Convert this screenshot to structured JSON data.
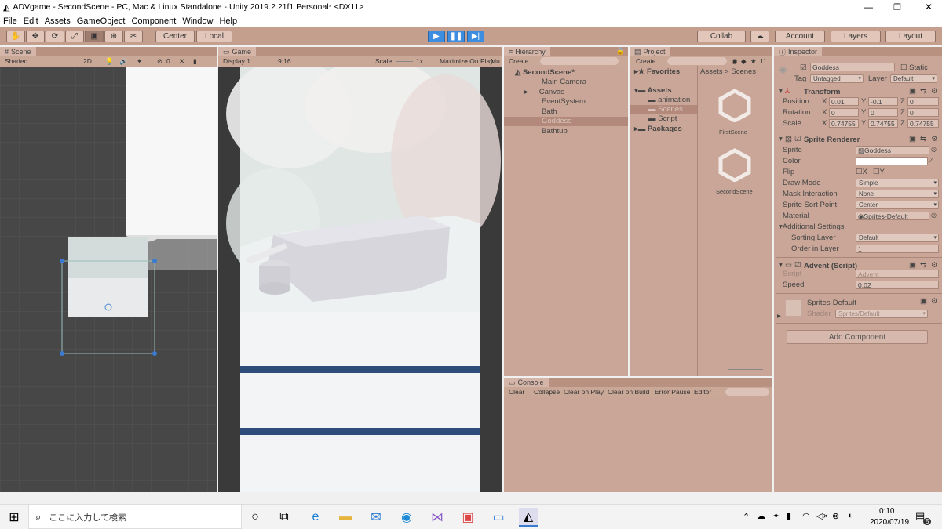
{
  "window": {
    "title": "ADVgame - SecondScene - PC, Mac & Linux Standalone - Unity 2019.2.21f1 Personal* <DX11>"
  },
  "menu": [
    "File",
    "Edit",
    "Assets",
    "GameObject",
    "Component",
    "Window",
    "Help"
  ],
  "toolbar": {
    "center": "Center",
    "local": "Local",
    "collab": "Collab",
    "account": "Account",
    "layers": "Layers",
    "layout": "Layout"
  },
  "scene": {
    "tab": "Scene",
    "shaded": "Shaded",
    "mode2d": "2D",
    "gizmo_count": "0"
  },
  "game": {
    "tab": "Game",
    "display": "Display 1",
    "aspect": "9:16",
    "scale_label": "Scale",
    "scale_value": "1x",
    "maximize": "Maximize On Play",
    "mute": "Mu"
  },
  "hierarchy": {
    "tab": "Hierarchy",
    "create": "Create",
    "scene": "SecondScene*",
    "items": [
      "Main Camera",
      "Canvas",
      "EventSystem",
      "Bath",
      "Goddess",
      "Bathtub"
    ]
  },
  "project": {
    "tab": "Project",
    "create": "Create",
    "favorites": "Favorites",
    "assets": "Assets",
    "folders": [
      "animation",
      "Scenes",
      "Script"
    ],
    "packages": "Packages",
    "breadcrumb_root": "Assets",
    "breadcrumb_sep": ">",
    "breadcrumb_leaf": "Scenes",
    "scene_files": [
      "FirstScene",
      "SecondScene"
    ],
    "icon_count": "11"
  },
  "console": {
    "tab": "Console",
    "buttons": [
      "Clear",
      "Collapse",
      "Clear on Play",
      "Clear on Build",
      "Error Pause",
      "Editor"
    ]
  },
  "inspector": {
    "tab": "Inspector",
    "object_name": "Goddess",
    "static": "Static",
    "tag_label": "Tag",
    "tag_value": "Untagged",
    "layer_label": "Layer",
    "layer_value": "Default",
    "transform": {
      "title": "Transform",
      "position": "Position",
      "rotation": "Rotation",
      "scale": "Scale",
      "pos": [
        "0.01",
        "-0.1",
        "0"
      ],
      "rot": [
        "0",
        "0",
        "0"
      ],
      "scl": [
        "0.74755",
        "0.74755",
        "0.74755"
      ],
      "x": "X",
      "y": "Y",
      "z": "Z"
    },
    "sprite_renderer": {
      "title": "Sprite Renderer",
      "sprite_label": "Sprite",
      "sprite_value": "Goddess",
      "color_label": "Color",
      "flip_label": "Flip",
      "flip_x": "X",
      "flip_y": "Y",
      "draw_mode_label": "Draw Mode",
      "draw_mode": "Simple",
      "mask_label": "Mask Interaction",
      "mask": "None",
      "sort_label": "Sprite Sort Point",
      "sort": "Center",
      "material_label": "Material",
      "material": "Sprites-Default",
      "additional": "Additional Settings",
      "sorting_layer_label": "Sorting Layer",
      "sorting_layer": "Default",
      "order_label": "Order in Layer",
      "order": "1"
    },
    "advent": {
      "title": "Advent (Script)",
      "script_label": "Script",
      "script_value": "Advent",
      "speed_label": "Speed",
      "speed": "0.02"
    },
    "material": {
      "name": "Sprites-Default",
      "shader_label": "Shader",
      "shader": "Sprites/Default"
    },
    "add_component": "Add Component"
  },
  "taskbar": {
    "search": "ここに入力して検索",
    "time": "0:10",
    "date": "2020/07/19",
    "notif": "5"
  },
  "colors": {
    "accent": "#3d8de0",
    "panel": "#c9a697",
    "toolbar": "#c49f8e",
    "scene_bg": "#474747"
  }
}
